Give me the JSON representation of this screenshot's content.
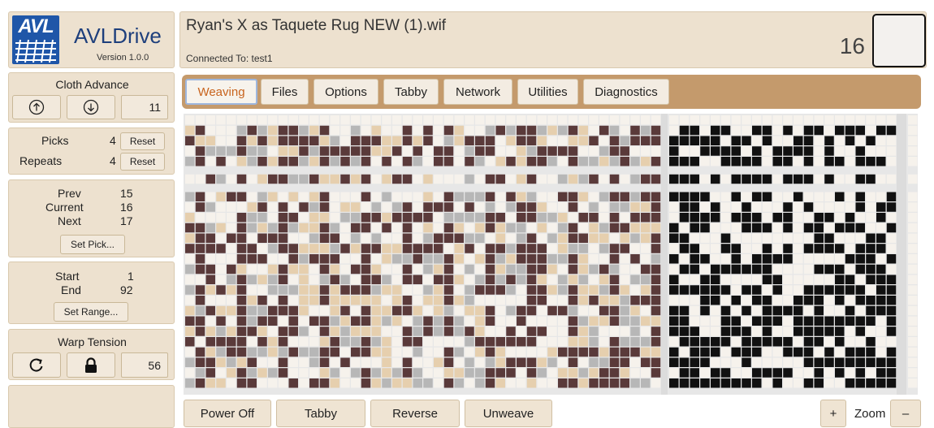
{
  "app": {
    "logo_text": "AVL",
    "name": "AVLDrive",
    "version": "Version 1.0.0"
  },
  "header": {
    "file_title": "Ryan's X as Taquete Rug NEW (1).wif",
    "connection": "Connected To: test1",
    "current_pick": "16"
  },
  "cloth_advance": {
    "title": "Cloth Advance",
    "up_icon": "arrow-up-circle",
    "down_icon": "arrow-down-circle",
    "value": "11"
  },
  "counters": {
    "picks_label": "Picks",
    "picks_value": "4",
    "repeats_label": "Repeats",
    "repeats_value": "4",
    "reset_label": "Reset"
  },
  "pick_info": {
    "prev_label": "Prev",
    "prev_value": "15",
    "current_label": "Current",
    "current_value": "16",
    "next_label": "Next",
    "next_value": "17",
    "set_pick_label": "Set Pick..."
  },
  "range": {
    "start_label": "Start",
    "start_value": "1",
    "end_label": "End",
    "end_value": "92",
    "set_range_label": "Set Range..."
  },
  "warp_tension": {
    "title": "Warp Tension",
    "refresh_icon": "refresh-icon",
    "lock_icon": "lock-icon",
    "value": "56"
  },
  "tabs": [
    {
      "label": "Weaving",
      "active": true
    },
    {
      "label": "Files",
      "active": false
    },
    {
      "label": "Options",
      "active": false
    },
    {
      "label": "Tabby",
      "active": false
    },
    {
      "label": "Network",
      "active": false
    },
    {
      "label": "Utilities",
      "active": false
    },
    {
      "label": "Diagnostics",
      "active": false
    }
  ],
  "bottom_bar": {
    "power_off": "Power Off",
    "tabby": "Tabby",
    "reverse": "Reverse",
    "unweave": "Unweave",
    "zoom_in": "+",
    "zoom_label": "Zoom",
    "zoom_out": "–"
  },
  "colors": {
    "panel": "#ede1cf",
    "tab_bar": "#c49a6c",
    "active_tab_text": "#c8631d",
    "dark_brown": "#5a3a3a",
    "tan": "#e6cfae",
    "gray": "#b7b7b7",
    "cream": "#f6f2ec"
  }
}
